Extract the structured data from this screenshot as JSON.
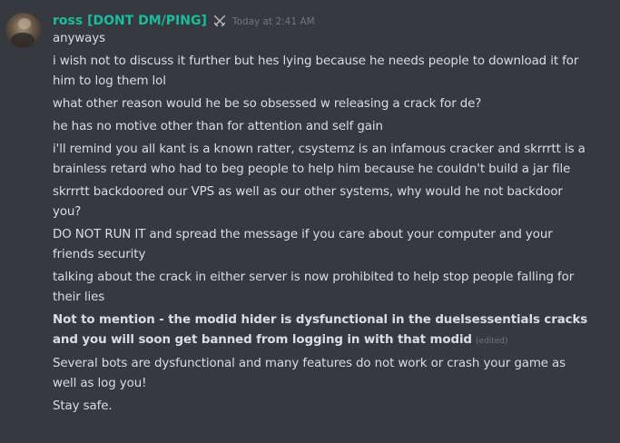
{
  "message": {
    "author": "ross [DONT DM/PING]",
    "author_color": "#1abc9c",
    "role_icon": "crossed-swords-icon",
    "timestamp": "Today at 2:41 AM",
    "lines": [
      "anyways",
      "i wish not to discuss it further but hes lying because he needs people to download it for him to log them lol",
      "what other reason would he be so obsessed w releasing a crack for de?",
      "he has no motive other than for attention and self gain",
      "i'll remind you all kant is a known ratter, csystemz is an infamous cracker and skrrrtt is a brainless retard who had to beg people to help him because he couldn't build a jar file",
      "skrrrtt backdoored our VPS as well as our other systems, why would he not backdoor you?",
      "DO NOT RUN IT and spread the message if you care about your computer and your friends security",
      "talking about the crack in either server is now prohibited to help stop people falling for their lies",
      "Not to mention - the modid hider is dysfunctional in the duelsessentials cracks and you will soon get banned from logging in with that modid",
      "Several bots are dysfunctional and many features do not work or crash your game as well as log you!",
      "Stay safe."
    ],
    "edited_label": "(edited)"
  }
}
